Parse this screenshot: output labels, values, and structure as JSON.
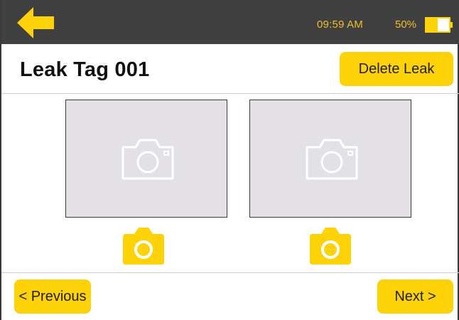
{
  "colors": {
    "accent": "#fdd207",
    "status_text": "#f1bf2a",
    "topbar_bg": "#404040",
    "photo_bg": "#e3e1e6"
  },
  "topbar": {
    "back_icon": "arrow-left-icon",
    "time": "09:59 AM",
    "battery_percent": "50%",
    "battery_icon": "battery-half-icon",
    "battery_level": 0.5
  },
  "header": {
    "title": "Leak Tag 001",
    "delete_label": "Delete Leak"
  },
  "photos": [
    {
      "placeholder_icon": "camera-placeholder-icon",
      "capture_icon": "camera-icon"
    },
    {
      "placeholder_icon": "camera-placeholder-icon",
      "capture_icon": "camera-icon"
    }
  ],
  "footer": {
    "previous_label": "< Previous",
    "next_label": "Next >"
  }
}
